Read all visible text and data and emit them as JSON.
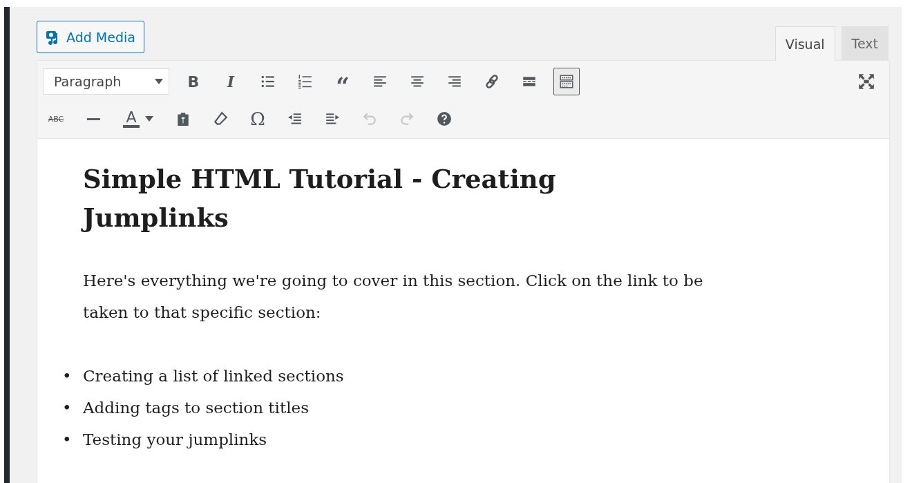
{
  "add_media": {
    "label": "Add Media"
  },
  "tabs": [
    {
      "label": "Visual",
      "selected": true
    },
    {
      "label": "Text",
      "selected": false
    }
  ],
  "toolbar": {
    "format": {
      "value": "Paragraph"
    },
    "row_1": [
      {
        "kind": "bold",
        "label": "B",
        "on": false,
        "disabled": false
      },
      {
        "kind": "italic",
        "label": "I",
        "on": false,
        "disabled": false
      },
      {
        "kind": "bullets",
        "on": false,
        "disabled": false
      },
      {
        "kind": "numbers",
        "on": false,
        "disabled": false
      },
      {
        "kind": "quote",
        "label": "“",
        "on": false,
        "disabled": false
      },
      {
        "kind": "align-left",
        "on": false,
        "disabled": false
      },
      {
        "kind": "align-center",
        "on": false,
        "disabled": false
      },
      {
        "kind": "align-right",
        "on": false,
        "disabled": false
      },
      {
        "kind": "link",
        "on": false,
        "disabled": false
      },
      {
        "kind": "more",
        "on": false,
        "disabled": false
      },
      {
        "kind": "toolbar-toggle",
        "on": true,
        "disabled": false
      }
    ],
    "row_2": [
      {
        "kind": "strike",
        "label": "ABC",
        "on": false,
        "disabled": false
      },
      {
        "kind": "hr",
        "on": false,
        "disabled": false
      },
      {
        "kind": "text-color",
        "label": "A",
        "on": false,
        "disabled": false
      },
      {
        "kind": "paste",
        "on": false,
        "disabled": false
      },
      {
        "kind": "eraser",
        "on": false,
        "disabled": false
      },
      {
        "kind": "omega",
        "label": "Ω",
        "on": false,
        "disabled": false
      },
      {
        "kind": "outdent",
        "on": false,
        "disabled": false
      },
      {
        "kind": "indent",
        "on": false,
        "disabled": false
      },
      {
        "kind": "undo",
        "on": false,
        "disabled": true
      },
      {
        "kind": "redo",
        "on": false,
        "disabled": true
      },
      {
        "kind": "help",
        "on": false,
        "disabled": false
      }
    ]
  },
  "content": {
    "heading": "Simple HTML Tutorial - Creating Jumplinks",
    "paragraph": "Here's everything we're going to cover in this section. Click on the link to be taken to that specific section:",
    "list": [
      {
        "marker": "•",
        "text": "Creating a list of linked sections"
      },
      {
        "marker": "•",
        "text": "Adding tags to section titles"
      },
      {
        "marker": "•",
        "text": "Testing your jumplinks"
      }
    ]
  }
}
